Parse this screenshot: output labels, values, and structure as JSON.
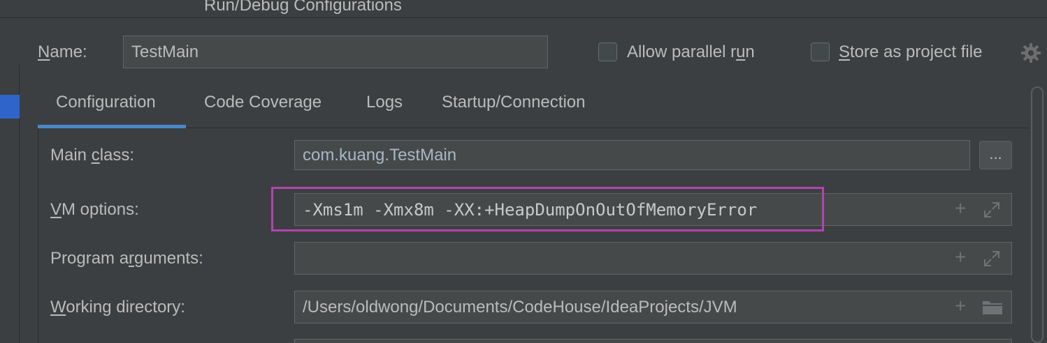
{
  "window": {
    "title": "Run/Debug Configurations"
  },
  "header": {
    "name_label_underlined": "N",
    "name_label_rest": "ame:",
    "name_value": "TestMain",
    "allow_parallel_pre": "Allow parallel r",
    "allow_parallel_u": "u",
    "allow_parallel_post": "n",
    "store_u": "S",
    "store_rest": "tore as project file",
    "gear_icon": "gear-icon"
  },
  "tabs": [
    {
      "label": "Configuration",
      "active": true
    },
    {
      "label": "Code Coverage",
      "active": false
    },
    {
      "label": "Logs",
      "active": false
    },
    {
      "label": "Startup/Connection",
      "active": false
    }
  ],
  "form": {
    "main_class": {
      "label_pre": "Main ",
      "label_u": "c",
      "label_post": "lass:",
      "value": "com.kuang.TestMain",
      "browse": "..."
    },
    "vm_options": {
      "label_u": "V",
      "label_post": "M options:",
      "value": "-Xms1m -Xmx8m -XX:+HeapDumpOnOutOfMemoryError"
    },
    "program_arguments": {
      "label_pre": "Program a",
      "label_u": "r",
      "label_post": "guments:",
      "value": ""
    },
    "working_directory": {
      "label_u": "W",
      "label_post": "orking directory:",
      "value": "/Users/oldwong/Documents/CodeHouse/IdeaProjects/JVM"
    }
  },
  "colors": {
    "background": "#3c3f41",
    "field": "#45494a",
    "accent": "#4a88c7",
    "highlight": "#b344b0",
    "selection": "#2f65ca"
  }
}
